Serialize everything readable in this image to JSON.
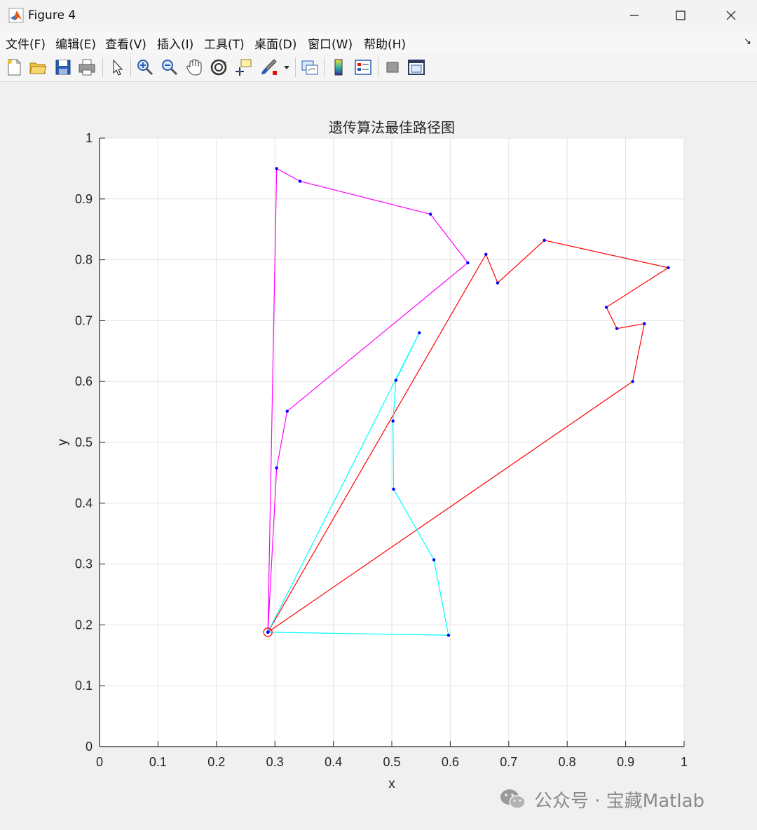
{
  "window": {
    "title": "Figure 4"
  },
  "menu": {
    "items": [
      "文件(F)",
      "编辑(E)",
      "查看(V)",
      "插入(I)",
      "工具(T)",
      "桌面(D)",
      "窗口(W)",
      "帮助(H)"
    ]
  },
  "toolbar": {
    "icons": [
      "new-figure-icon",
      "open-file-icon",
      "save-icon",
      "print-icon",
      "select-arrow-icon",
      "zoom-in-icon",
      "zoom-out-icon",
      "pan-hand-icon",
      "rotate-3d-icon",
      "data-cursor-icon",
      "brush-icon",
      "brush-dropdown-icon",
      "link-plot-icon",
      "colorbar-icon",
      "legend-icon",
      "hide-plot-tools-icon",
      "show-plot-tools-icon"
    ]
  },
  "watermark": {
    "text": "公众号 · 宝藏Matlab"
  },
  "chart_data": {
    "type": "line",
    "title": "遗传算法最佳路径图",
    "xlabel": "x",
    "ylabel": "y",
    "xlim": [
      0,
      1
    ],
    "ylim": [
      0,
      1
    ],
    "xticks": [
      "0",
      "0.1",
      "0.2",
      "0.3",
      "0.4",
      "0.5",
      "0.6",
      "0.7",
      "0.8",
      "0.9",
      "1"
    ],
    "yticks": [
      "0",
      "0.1",
      "0.2",
      "0.3",
      "0.4",
      "0.5",
      "0.6",
      "0.7",
      "0.8",
      "0.9",
      "1"
    ],
    "grid": true,
    "legend": "none",
    "depot": {
      "x": 0.288,
      "y": 0.188,
      "marker_color": "#ff0000"
    },
    "point_color": "#0000ff",
    "series": [
      {
        "color": "#ff00ff",
        "points": [
          [
            0.288,
            0.188
          ],
          [
            0.303,
            0.95
          ],
          [
            0.343,
            0.929
          ],
          [
            0.566,
            0.875
          ],
          [
            0.63,
            0.795
          ],
          [
            0.321,
            0.551
          ],
          [
            0.303,
            0.458
          ],
          [
            0.288,
            0.188
          ]
        ]
      },
      {
        "color": "#ff0000",
        "points": [
          [
            0.288,
            0.188
          ],
          [
            0.661,
            0.809
          ],
          [
            0.681,
            0.762
          ],
          [
            0.761,
            0.832
          ],
          [
            0.973,
            0.787
          ],
          [
            0.867,
            0.722
          ],
          [
            0.885,
            0.687
          ],
          [
            0.932,
            0.695
          ],
          [
            0.912,
            0.6
          ],
          [
            0.288,
            0.188
          ]
        ]
      },
      {
        "color": "#00ffff",
        "points": [
          [
            0.288,
            0.188
          ],
          [
            0.597,
            0.183
          ],
          [
            0.572,
            0.307
          ],
          [
            0.503,
            0.423
          ],
          [
            0.502,
            0.535
          ],
          [
            0.507,
            0.602
          ],
          [
            0.547,
            0.68
          ],
          [
            0.288,
            0.188
          ]
        ]
      }
    ]
  }
}
